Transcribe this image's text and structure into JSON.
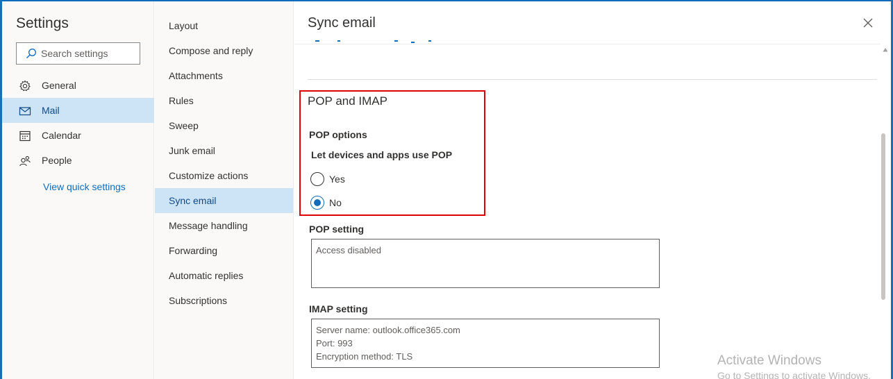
{
  "app": {
    "title": "Settings"
  },
  "search": {
    "placeholder": "Search settings"
  },
  "categories": [
    {
      "label": "General",
      "icon": "gear-icon"
    },
    {
      "label": "Mail",
      "icon": "mail-icon",
      "selected": true
    },
    {
      "label": "Calendar",
      "icon": "calendar-icon"
    },
    {
      "label": "People",
      "icon": "people-icon"
    }
  ],
  "quick_settings_link": "View quick settings",
  "mail_sections": [
    "Layout",
    "Compose and reply",
    "Attachments",
    "Rules",
    "Sweep",
    "Junk email",
    "Customize actions",
    "Sync email",
    "Message handling",
    "Forwarding",
    "Automatic replies",
    "Subscriptions"
  ],
  "selected_section": "Sync email",
  "pane": {
    "title": "Sync email",
    "section_heading": "POP and IMAP",
    "pop_options_label": "POP options",
    "pop_question": "Let devices and apps use POP",
    "radio_options": [
      {
        "label": "Yes",
        "checked": false
      },
      {
        "label": "No",
        "checked": true
      }
    ],
    "pop_setting_label": "POP setting",
    "pop_setting_value": "Access disabled",
    "imap_setting_label": "IMAP setting",
    "imap_setting_lines": [
      "Server name: outlook.office365.com",
      "Port: 993",
      "Encryption method: TLS"
    ]
  },
  "watermark": {
    "line1": "Activate Windows",
    "line2": "Go to Settings to activate Windows."
  },
  "colors": {
    "accent": "#0f6cbd",
    "selected_bg": "#cce4f6",
    "highlight": "#e00000"
  }
}
